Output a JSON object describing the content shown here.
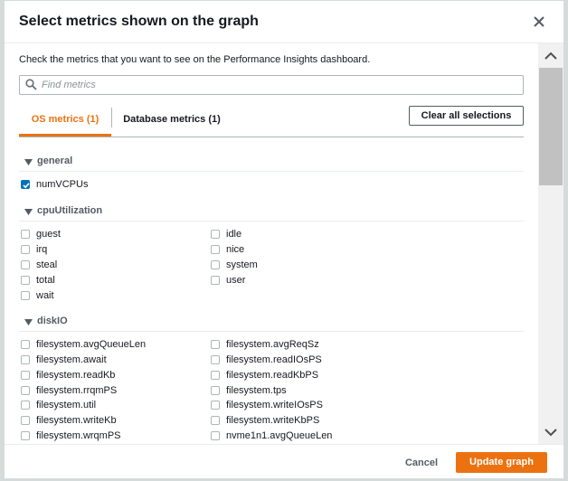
{
  "dialog": {
    "title": "Select metrics shown on the graph",
    "description": "Check the metrics that you want to see on the Performance Insights dashboard."
  },
  "search": {
    "placeholder": "Find metrics"
  },
  "tabs": [
    {
      "label": "OS metrics (1)",
      "active": true
    },
    {
      "label": "Database metrics (1)",
      "active": false
    }
  ],
  "clear_label": "Clear all selections",
  "sections": {
    "general": {
      "title": "general",
      "items": [
        {
          "label": "numVCPUs",
          "checked": true
        }
      ]
    },
    "cpu": {
      "title": "cpuUtilization",
      "items": [
        {
          "label": "guest",
          "checked": false
        },
        {
          "label": "idle",
          "checked": false
        },
        {
          "label": "irq",
          "checked": false
        },
        {
          "label": "nice",
          "checked": false
        },
        {
          "label": "steal",
          "checked": false
        },
        {
          "label": "system",
          "checked": false
        },
        {
          "label": "total",
          "checked": false
        },
        {
          "label": "user",
          "checked": false
        },
        {
          "label": "wait",
          "checked": false
        }
      ]
    },
    "disk": {
      "title": "diskIO",
      "items": [
        {
          "label": "filesystem.avgQueueLen",
          "checked": false
        },
        {
          "label": "filesystem.avgReqSz",
          "checked": false
        },
        {
          "label": "filesystem.await",
          "checked": false
        },
        {
          "label": "filesystem.readIOsPS",
          "checked": false
        },
        {
          "label": "filesystem.readKb",
          "checked": false
        },
        {
          "label": "filesystem.readKbPS",
          "checked": false
        },
        {
          "label": "filesystem.rrqmPS",
          "checked": false
        },
        {
          "label": "filesystem.tps",
          "checked": false
        },
        {
          "label": "filesystem.util",
          "checked": false
        },
        {
          "label": "filesystem.writeIOsPS",
          "checked": false
        },
        {
          "label": "filesystem.writeKb",
          "checked": false
        },
        {
          "label": "filesystem.writeKbPS",
          "checked": false
        },
        {
          "label": "filesystem.wrqmPS",
          "checked": false
        },
        {
          "label": "nvme1n1.avgQueueLen",
          "checked": false
        }
      ]
    }
  },
  "footer": {
    "cancel_label": "Cancel",
    "update_label": "Update graph"
  },
  "colors": {
    "accent": "#ec7211",
    "checkbox_checked": "#0073bb"
  }
}
